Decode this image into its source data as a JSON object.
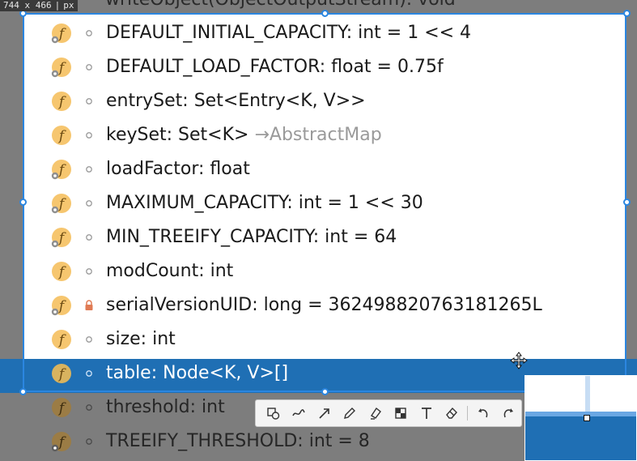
{
  "overlay": {
    "size_width": "744",
    "size_x": "x",
    "size_height": "466",
    "size_unit": "px",
    "background_text": "writeObject(ObjectOutputStream): void"
  },
  "members": [
    {
      "name": "DEFAULT_INITIAL_CAPACITY",
      "type": ": int = 1 << 4",
      "dim": "",
      "icon": "field-final-icon",
      "modifier": "package"
    },
    {
      "name": "DEFAULT_LOAD_FACTOR",
      "type": ": float = 0.75f",
      "dim": "",
      "icon": "field-final-icon",
      "modifier": "package"
    },
    {
      "name": "entrySet",
      "type": ": Set<Entry<K, V>>",
      "dim": "",
      "icon": "field-icon",
      "modifier": "package"
    },
    {
      "name": "keySet",
      "type": ": Set<K> ",
      "dim": "→AbstractMap",
      "icon": "field-icon",
      "modifier": "package"
    },
    {
      "name": "loadFactor",
      "type": ": float",
      "dim": "",
      "icon": "field-final-icon",
      "modifier": "package"
    },
    {
      "name": "MAXIMUM_CAPACITY",
      "type": ": int = 1 << 30",
      "dim": "",
      "icon": "field-final-icon",
      "modifier": "package"
    },
    {
      "name": "MIN_TREEIFY_CAPACITY",
      "type": ": int = 64",
      "dim": "",
      "icon": "field-final-icon",
      "modifier": "package"
    },
    {
      "name": "modCount",
      "type": ": int",
      "dim": "",
      "icon": "field-icon",
      "modifier": "package"
    },
    {
      "name": "serialVersionUID",
      "type": ": long = 362498820763181265L",
      "dim": "",
      "icon": "field-final-icon",
      "modifier": "private"
    },
    {
      "name": "size",
      "type": ": int",
      "dim": "",
      "icon": "field-icon",
      "modifier": "package"
    },
    {
      "name": "table",
      "type": ": Node<K, V>[]",
      "dim": "",
      "icon": "field-icon",
      "modifier": "package",
      "selected": true
    },
    {
      "name": "threshold",
      "type": ": int",
      "dim": "",
      "icon": "field-icon",
      "modifier": "package"
    },
    {
      "name": "TREEIFY_THRESHOLD",
      "type": ": int = 8",
      "dim": "",
      "icon": "field-final-icon",
      "modifier": "package"
    }
  ],
  "toolbar": {
    "tools": [
      "rectangle-ellipse-icon",
      "freehand-line-icon",
      "arrow-icon",
      "pencil-icon",
      "highlighter-icon",
      "mosaic-icon",
      "text-icon",
      "eraser-icon",
      "undo-icon",
      "redo-icon"
    ]
  },
  "colors": {
    "selection_border": "#2b86e0",
    "selected_row": "#1f6fb4",
    "field_icon_bg": "#f6c66f",
    "dimmed_bg": "#7d7d7d"
  }
}
